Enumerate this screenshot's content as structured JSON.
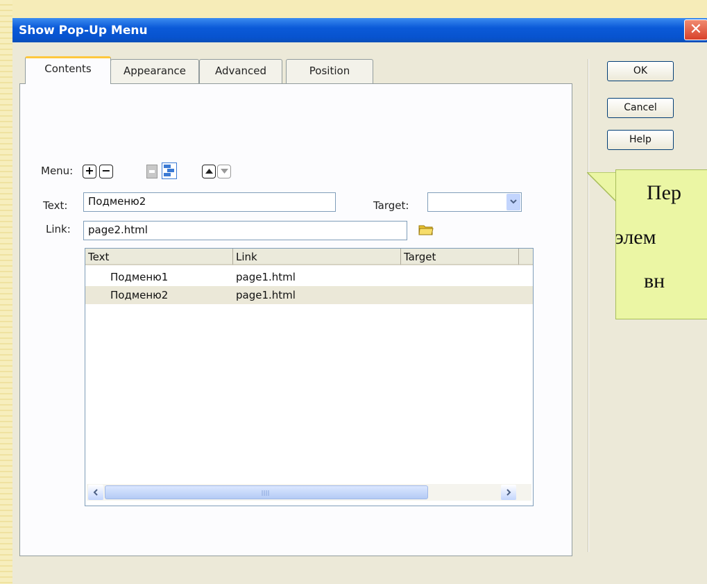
{
  "window": {
    "title": "Show Pop-Up Menu",
    "close_glyph": "✕"
  },
  "tabs": [
    {
      "label": "Contents",
      "active": true
    },
    {
      "label": "Appearance",
      "active": false
    },
    {
      "label": "Advanced",
      "active": false
    },
    {
      "label": "Position",
      "active": false
    }
  ],
  "buttons": {
    "ok": "OK",
    "cancel": "Cancel",
    "help": "Help"
  },
  "form": {
    "menu_label": "Menu:",
    "text_label": "Text:",
    "text_value": "Подменю2",
    "target_label": "Target:",
    "target_value": "",
    "link_label": "Link:",
    "link_value": "page2.html"
  },
  "toolbar_icons": [
    "plus-icon",
    "minus-icon",
    "outdent-icon",
    "indent-icon",
    "move-up-icon",
    "move-down-icon",
    "folder-icon"
  ],
  "table": {
    "columns": [
      "Text",
      "Link",
      "Target"
    ],
    "rows": [
      {
        "text": "Подменю1",
        "link": "page1.html",
        "target": ""
      },
      {
        "text": "Подменю2",
        "link": "page1.html",
        "target": ""
      }
    ],
    "selected_row": 1
  },
  "callout": {
    "line1": "Пер",
    "line2": "элем",
    "line3": "вн"
  },
  "colors": {
    "title_bar": "#0b5ad8",
    "dialog_bg": "#ece9d8",
    "callout_bg": "#ebf6a4",
    "selected_row": "#ebe8d8"
  }
}
